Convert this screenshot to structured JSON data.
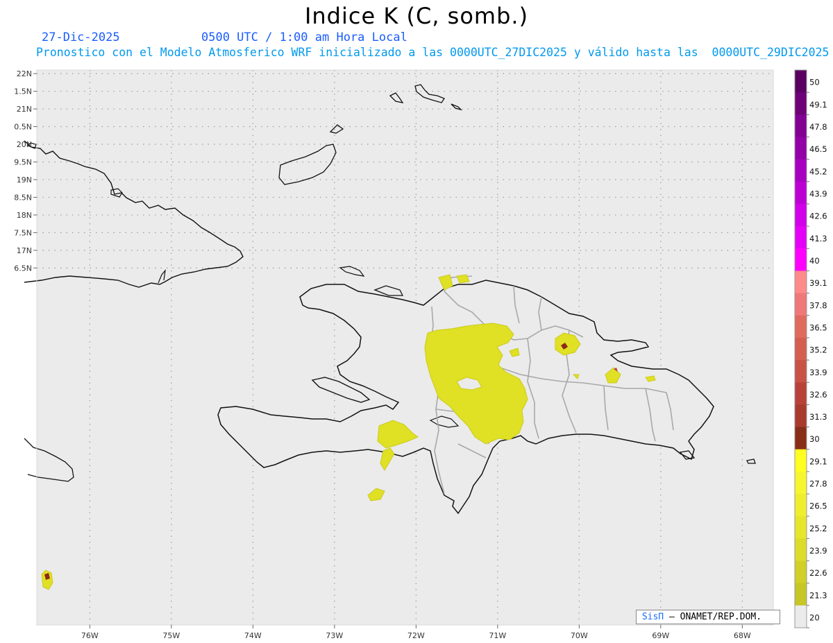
{
  "title": "Indice K (C, somb.)",
  "header": {
    "date": "27-Dic-2025",
    "time": "0500 UTC / 1:00 am Hora Local",
    "description": "Pronostico con el Modelo Atmosferico WRF inicializado a las 0000UTC_27DIC2025 y válido hasta las  0000UTC_29DIC2025"
  },
  "map": {
    "lon_range": [
      -76.65,
      -67.62
    ],
    "lat_range": [
      6.4,
      22.1
    ],
    "lon_ticks": [
      {
        "value": -76,
        "label": "76W"
      },
      {
        "value": -75,
        "label": "75W"
      },
      {
        "value": -74,
        "label": "74W"
      },
      {
        "value": -73,
        "label": "73W"
      },
      {
        "value": -72,
        "label": "72W"
      },
      {
        "value": -71,
        "label": "71W"
      },
      {
        "value": -70,
        "label": "70W"
      },
      {
        "value": -69,
        "label": "69W"
      },
      {
        "value": -68,
        "label": "68W"
      }
    ],
    "lat_ticks": [
      {
        "value": 22,
        "label": "22N"
      },
      {
        "value": 21.5,
        "label": "1.5N"
      },
      {
        "value": 21,
        "label": "21N"
      },
      {
        "value": 20.5,
        "label": "0.5N"
      },
      {
        "value": 20,
        "label": "20N"
      },
      {
        "value": 19.5,
        "label": "9.5N"
      },
      {
        "value": 19,
        "label": "19N"
      },
      {
        "value": 18.5,
        "label": "8.5N"
      },
      {
        "value": 18,
        "label": "18N"
      },
      {
        "value": 17.5,
        "label": "7.5N"
      },
      {
        "value": 17,
        "label": "17N"
      },
      {
        "value": 16.5,
        "label": "6.5N"
      }
    ],
    "background_color": "#ebebeb",
    "grid": "dotted"
  },
  "colorbar": {
    "levels": [
      "50",
      "49.1",
      "47.8",
      "46.5",
      "45.2",
      "43.9",
      "42.6",
      "41.3",
      "40",
      "39.1",
      "37.8",
      "36.5",
      "35.2",
      "33.9",
      "32.6",
      "31.3",
      "30",
      "29.1",
      "27.8",
      "26.5",
      "25.2",
      "23.9",
      "22.6",
      "21.3",
      "20"
    ],
    "colors": [
      "#5a0060",
      "#6e0078",
      "#820094",
      "#9400a8",
      "#a800c0",
      "#bc00d4",
      "#d200e8",
      "#e400f6",
      "#ff00ff",
      "#ff8a8a",
      "#f07878",
      "#e06a5e",
      "#d45e50",
      "#c85246",
      "#b8423a",
      "#a83a2e",
      "#882e18",
      "#ffff22",
      "#f6f62e",
      "#eeee2e",
      "#e6e62c",
      "#dcdc2a",
      "#d0d028",
      "#c6c626",
      "#ebebeb"
    ]
  },
  "credit": {
    "brand": "SisΠ",
    "text": " – ONAMET/REP.DOM."
  }
}
